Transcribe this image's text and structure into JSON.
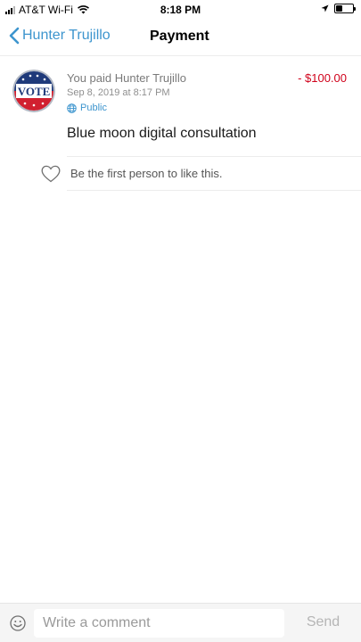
{
  "status_bar": {
    "carrier": "AT&T Wi-Fi",
    "time": "8:18 PM",
    "battery_level": 0.4
  },
  "nav": {
    "back_label": "Hunter Trujillo",
    "title": "Payment"
  },
  "story": {
    "avatar_text": "VOTE",
    "headline": "You paid Hunter Trujillo",
    "amount": "- $100.00",
    "date": "Sep 8, 2019 at 8:17 PM",
    "audience": "Public",
    "note": "Blue moon digital consultation",
    "like_prompt": "Be the first person to like this."
  },
  "comment": {
    "placeholder": "Write a comment",
    "send_label": "Send"
  },
  "colors": {
    "accent": "#3d95ce",
    "amount_negative": "#d0021b"
  }
}
